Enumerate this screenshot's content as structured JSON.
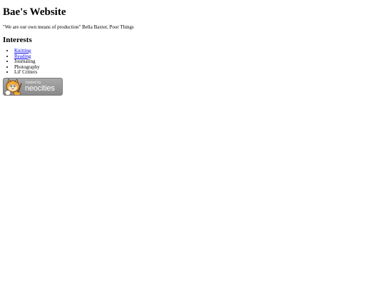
{
  "site": {
    "title": "Bae's Website",
    "quote": "\"We are our own means of production\" Bella Baxter, Poor Things"
  },
  "interests": {
    "heading": "Interests",
    "items": [
      {
        "label": "Knitting",
        "is_link": true
      },
      {
        "label": "Reading",
        "is_link": true
      },
      {
        "label": "Journaling",
        "is_link": false
      },
      {
        "label": "Photography",
        "is_link": false
      },
      {
        "label": "Lil' Critters",
        "is_link": false
      }
    ]
  },
  "badge": {
    "small_text": "hosted by",
    "brand_text": "neocities",
    "icon": "neocities-cat-icon"
  },
  "colors": {
    "link": "#0000ee",
    "badge_bg": "#9a9a9a"
  }
}
